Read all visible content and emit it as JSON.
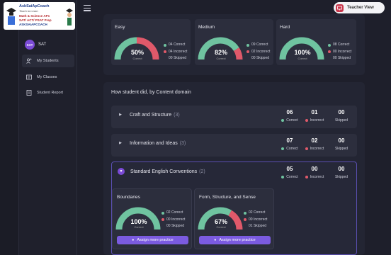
{
  "app": {
    "logo_lines": [
      "AskSaiApCoach",
      "Teach to Learn",
      "Math & Science APs",
      "SAT/ ACT/ PSAT Prep",
      "ASKSAIAPCOACH"
    ],
    "teacher_view_label": "Teacher View"
  },
  "user": {
    "avatar_initials": "SAT",
    "name": "SAT"
  },
  "nav": {
    "items": [
      {
        "label": "My Students",
        "icon": "students-icon",
        "active": true
      },
      {
        "label": "My Classes",
        "icon": "classes-icon",
        "active": false
      },
      {
        "label": "Student Report",
        "icon": "report-icon",
        "active": false
      }
    ]
  },
  "difficulty": [
    {
      "title": "Easy",
      "percent_label": "50%",
      "sub": "Correct",
      "percent": 50,
      "correct": "04 Correct",
      "incorrect": "04 Incorrect",
      "skipped": "00 Skipped"
    },
    {
      "title": "Medium",
      "percent_label": "82%",
      "sub": "Correct",
      "percent": 82,
      "correct": "09 Correct",
      "incorrect": "02 Incorrect",
      "skipped": "00 Skipped"
    },
    {
      "title": "Hard",
      "percent_label": "100%",
      "sub": "Correct",
      "percent": 100,
      "correct": "08 Correct",
      "incorrect": "00 Incorrect",
      "skipped": "00 Skipped"
    }
  ],
  "content_section_title": "How student did, by Content domain",
  "domains": [
    {
      "name": "Craft and Structure",
      "count": "(3)",
      "correct": "06",
      "incorrect": "01",
      "skipped": "00",
      "expanded": false
    },
    {
      "name": "Information and Ideas",
      "count": "(3)",
      "correct": "07",
      "incorrect": "02",
      "skipped": "00",
      "expanded": false
    },
    {
      "name": "Standard English Conventions",
      "count": "(2)",
      "correct": "05",
      "incorrect": "00",
      "skipped": "00",
      "expanded": true
    }
  ],
  "stat_labels": {
    "correct": "Correct",
    "incorrect": "Incorrect",
    "skipped": "Skipped"
  },
  "skills": [
    {
      "title": "Boundaries",
      "percent_label": "100%",
      "sub": "Correct",
      "percent": 100,
      "correct": "02 Correct",
      "incorrect": "00 Incorrect",
      "skipped": "00 Skipped",
      "button": "Assign more practice"
    },
    {
      "title": "Form, Structure, and Sense",
      "percent_label": "67%",
      "sub": "Correct",
      "percent": 67,
      "correct": "02 Correct",
      "incorrect": "00 Incorrect",
      "skipped": "01 Skipped",
      "button": "Assign more practice"
    }
  ],
  "colors": {
    "correct": "#6fc3a0",
    "incorrect": "#e0596a",
    "accent": "#7b5be0",
    "track": "#3a3c4e"
  }
}
